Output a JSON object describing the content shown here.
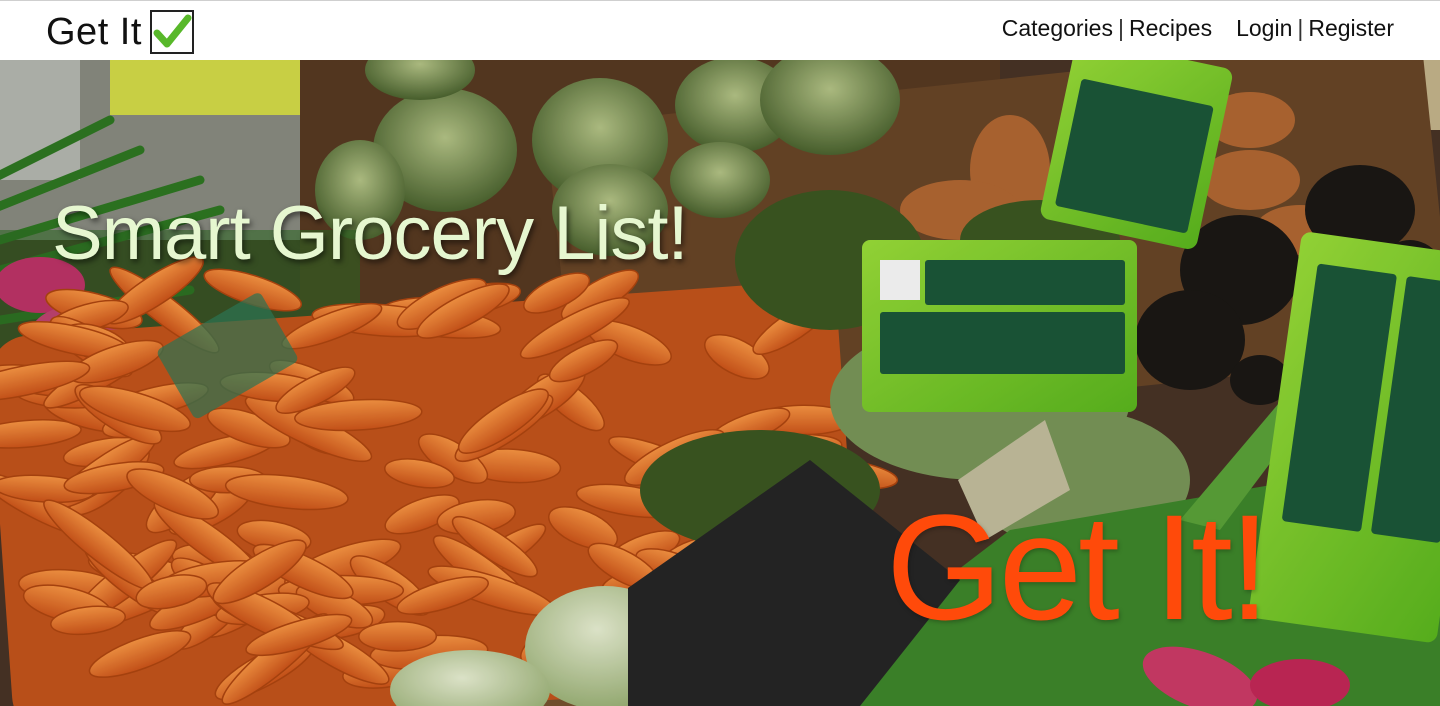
{
  "navbar": {
    "brand": "Get It",
    "brand_icon": "checkmark-icon",
    "links": {
      "categories": "Categories",
      "recipes": "Recipes",
      "login": "Login",
      "register": "Register"
    },
    "separator": "|"
  },
  "hero": {
    "title": "Smart Grocery List!",
    "cta": "Get It!",
    "title_color": "#e6f7d0",
    "cta_color": "#ff4a0a"
  },
  "colors": {
    "accent_check": "#58b82a"
  }
}
